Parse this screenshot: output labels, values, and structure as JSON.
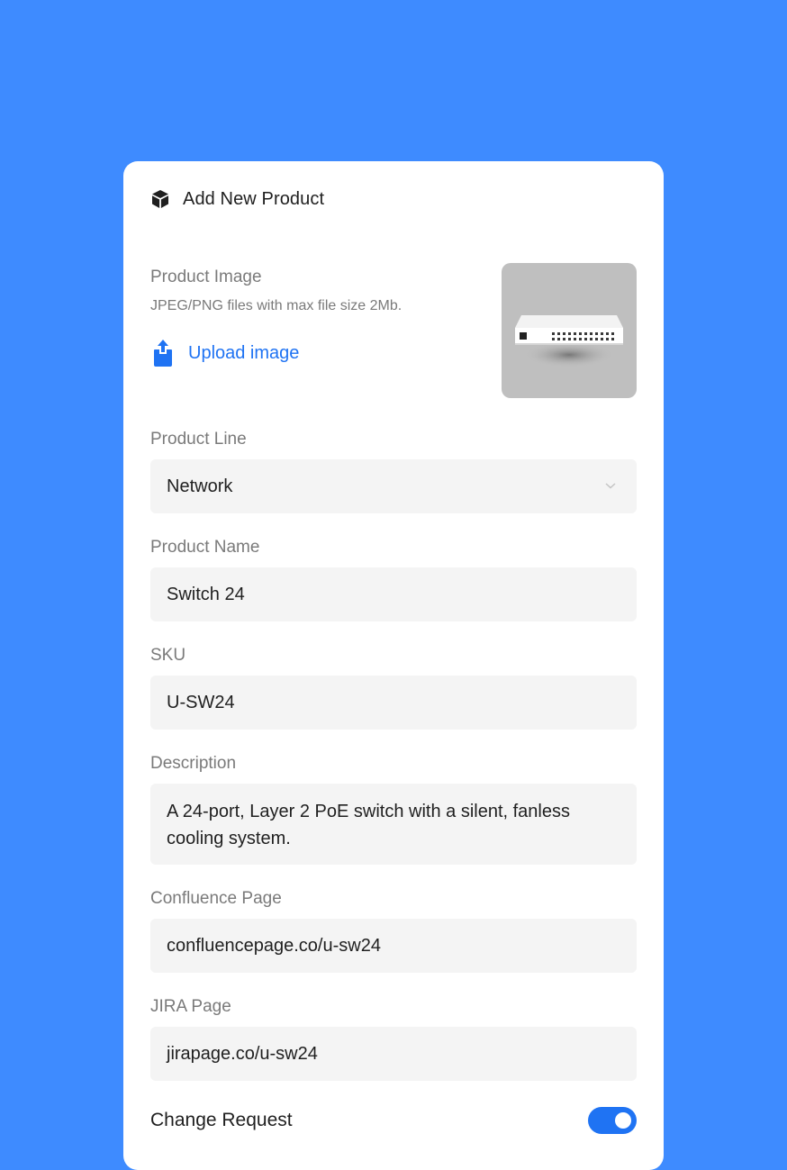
{
  "header": {
    "title": "Add New Product",
    "icon": "box-icon"
  },
  "product_image": {
    "label": "Product Image",
    "hint": "JPEG/PNG files with max file size 2Mb.",
    "upload_label": "Upload image",
    "upload_icon": "upload-icon",
    "preview_alt": "network switch"
  },
  "fields": {
    "product_line": {
      "label": "Product Line",
      "value": "Network",
      "icon": "chevron-down-icon"
    },
    "product_name": {
      "label": "Product Name",
      "value": "Switch 24"
    },
    "sku": {
      "label": "SKU",
      "value": "U-SW24"
    },
    "description": {
      "label": "Description",
      "value": "A 24-port, Layer 2 PoE switch with a silent, fanless cooling system."
    },
    "confluence_page": {
      "label": "Confluence Page",
      "value": "confluencepage.co/u-sw24"
    },
    "jira_page": {
      "label": "JIRA Page",
      "value": "jirapage.co/u-sw24"
    }
  },
  "change_request": {
    "label": "Change Request",
    "enabled": true
  },
  "colors": {
    "background": "#3e8bff",
    "accent": "#1f73f3",
    "field_bg": "#f4f4f4",
    "label_text": "#7a7a7a"
  }
}
